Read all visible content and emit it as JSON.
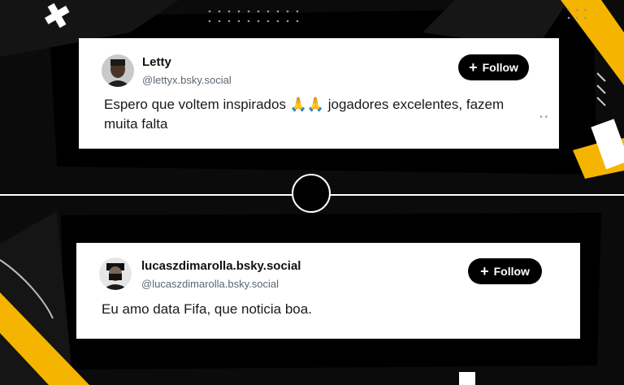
{
  "posts": [
    {
      "name": "Letty",
      "handle": "@lettyx.bsky.social",
      "follow_label": "Follow",
      "text": "Espero que voltem inspirados 🙏🙏 jogadores excelentes, fazem muita falta"
    },
    {
      "name": "lucaszdimarolla.bsky.social",
      "handle": "@lucaszdimarolla.bsky.social",
      "follow_label": "Follow",
      "text": "Eu amo data Fifa, que noticia boa."
    }
  ],
  "colors": {
    "accent": "#f5b400",
    "background": "#0b0b0b",
    "card": "#ffffff",
    "button": "#000000"
  },
  "icons": {
    "follow": "plus-icon"
  }
}
